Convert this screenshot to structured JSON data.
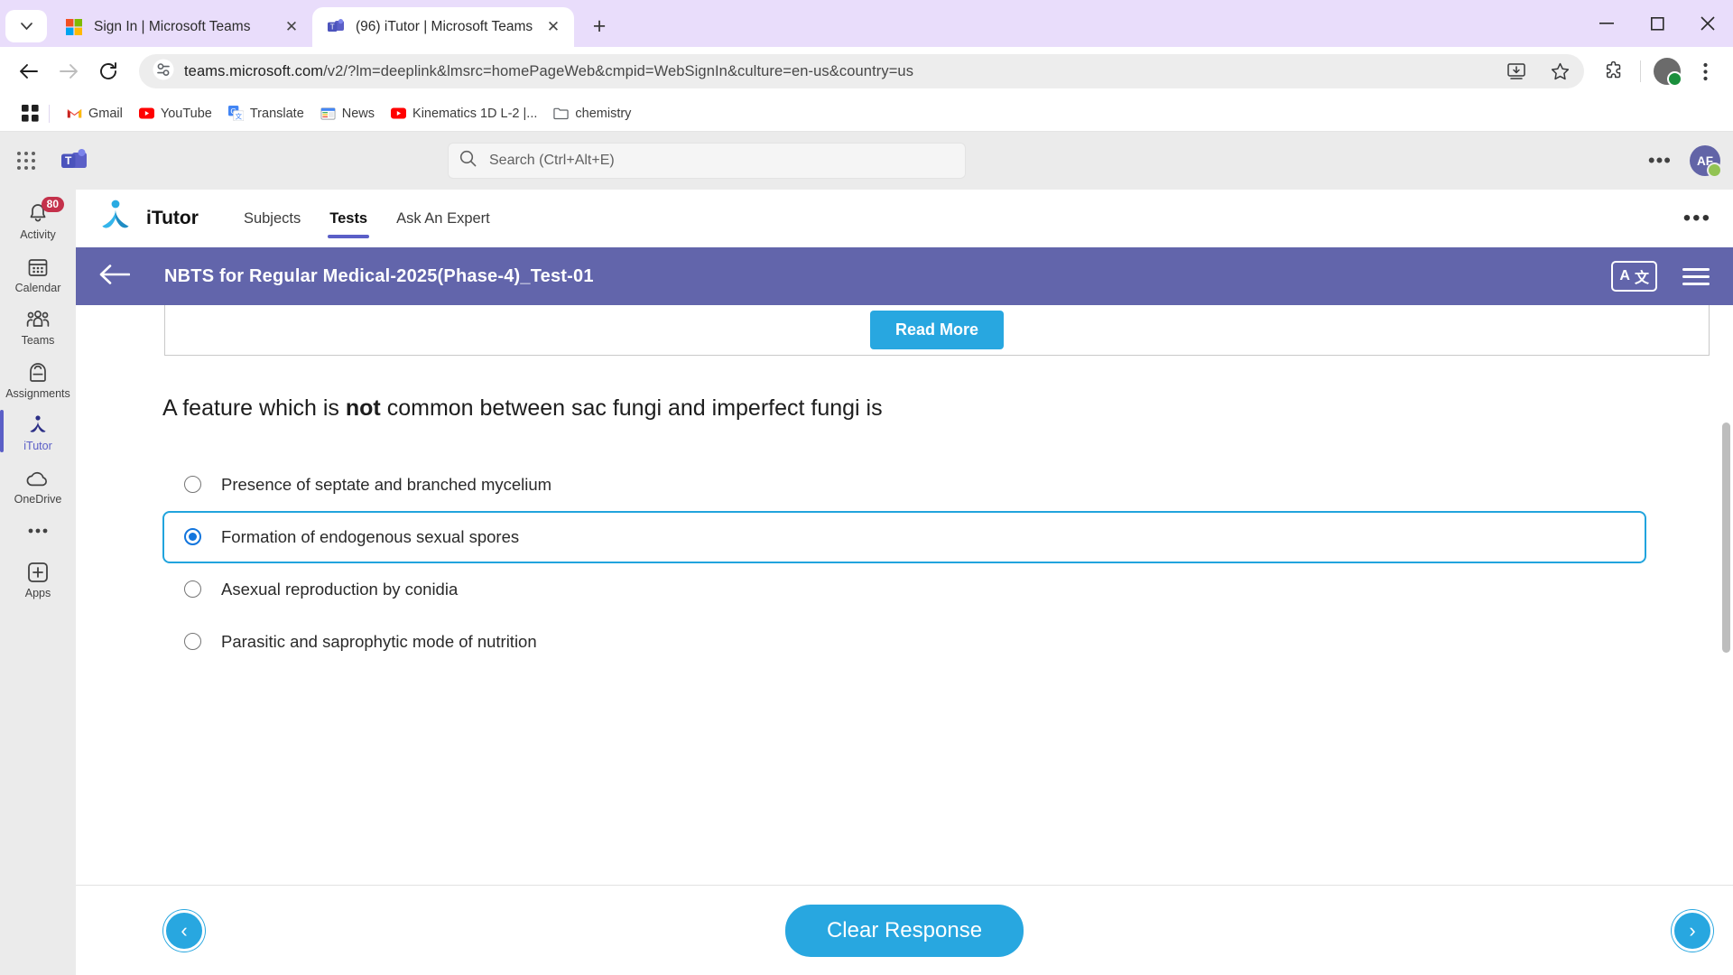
{
  "browser": {
    "tabs": [
      {
        "title": "Sign In | Microsoft Teams",
        "favicon": "microsoft-icon",
        "active": false,
        "close_label": "✕"
      },
      {
        "title": "(96) iTutor | Microsoft Teams",
        "favicon": "teams-icon",
        "active": true,
        "close_label": "✕"
      }
    ],
    "tab_search_label": "⌄",
    "new_tab_label": "+",
    "window_controls": {
      "minimize": "–",
      "maximize": "☐",
      "close": "✕"
    },
    "nav": {
      "back": "←",
      "forward": "→",
      "reload": "↻"
    },
    "url": {
      "domain": "teams.microsoft.com",
      "path": "/v2/?lm=deeplink&lmsrc=homePageWeb&cmpid=WebSignIn&culture=en-us&country=us"
    },
    "omnibox_icons": {
      "site_info": "tune-icon",
      "install": "install-icon",
      "bookmark": "star-icon",
      "extensions": "extensions-icon",
      "menu": "kebab-menu-icon"
    },
    "bookmarks": [
      {
        "label": "Gmail",
        "icon": "gmail-icon"
      },
      {
        "label": "YouTube",
        "icon": "youtube-icon"
      },
      {
        "label": "Translate",
        "icon": "translate-icon"
      },
      {
        "label": "News",
        "icon": "news-icon"
      },
      {
        "label": "Kinematics 1D L-2 |...",
        "icon": "youtube-icon"
      },
      {
        "label": "chemistry",
        "icon": "folder-icon"
      }
    ]
  },
  "teams": {
    "search": {
      "placeholder": "Search (Ctrl+Alt+E)"
    },
    "more_label": "•••",
    "avatar_initials": "AF",
    "rail": [
      {
        "label": "Activity",
        "icon": "bell-icon",
        "badge": "80",
        "active": false
      },
      {
        "label": "Calendar",
        "icon": "calendar-icon",
        "badge": "",
        "active": false
      },
      {
        "label": "Teams",
        "icon": "people-icon",
        "badge": "",
        "active": false
      },
      {
        "label": "Assignments",
        "icon": "backpack-icon",
        "badge": "",
        "active": false
      },
      {
        "label": "iTutor",
        "icon": "itutor-icon",
        "badge": "",
        "active": true
      },
      {
        "label": "OneDrive",
        "icon": "cloud-icon",
        "badge": "",
        "active": false
      },
      {
        "label": "",
        "icon": "more-dots-icon",
        "badge": "",
        "active": false
      },
      {
        "label": "Apps",
        "icon": "plus-box-icon",
        "badge": "",
        "active": false
      }
    ]
  },
  "itutor": {
    "brand": "iTutor",
    "nav_items": [
      {
        "label": "Subjects",
        "active": false
      },
      {
        "label": "Tests",
        "active": true
      },
      {
        "label": "Ask An Expert",
        "active": false
      }
    ],
    "overflow_label": "•••"
  },
  "test": {
    "title": "NBTS for Regular Medical-2025(Phase-4)_Test-01",
    "back_label": "←",
    "translate_label": "A",
    "translate_label2": "文",
    "read_more_label": "Read More",
    "question": {
      "before": "A feature which is ",
      "emphasis": "not",
      "after": " common between sac fungi and imperfect fungi is"
    },
    "options": [
      {
        "label": "Presence of septate and branched mycelium",
        "selected": false
      },
      {
        "label": "Formation of endogenous sexual spores",
        "selected": true
      },
      {
        "label": "Asexual reproduction by conidia",
        "selected": false
      },
      {
        "label": "Parasitic and saprophytic mode of nutrition",
        "selected": false
      }
    ],
    "footer": {
      "prev_label": "‹",
      "clear_label": "Clear Response",
      "next_label": "›"
    }
  },
  "colors": {
    "tabstrip": "#e9ddfb",
    "teams_purple": "#6265ab",
    "accent_blue": "#28a7e0",
    "selected_radio": "#1275dd",
    "badge_red": "#c4314b",
    "itutor_active": "#5b5fc7"
  }
}
